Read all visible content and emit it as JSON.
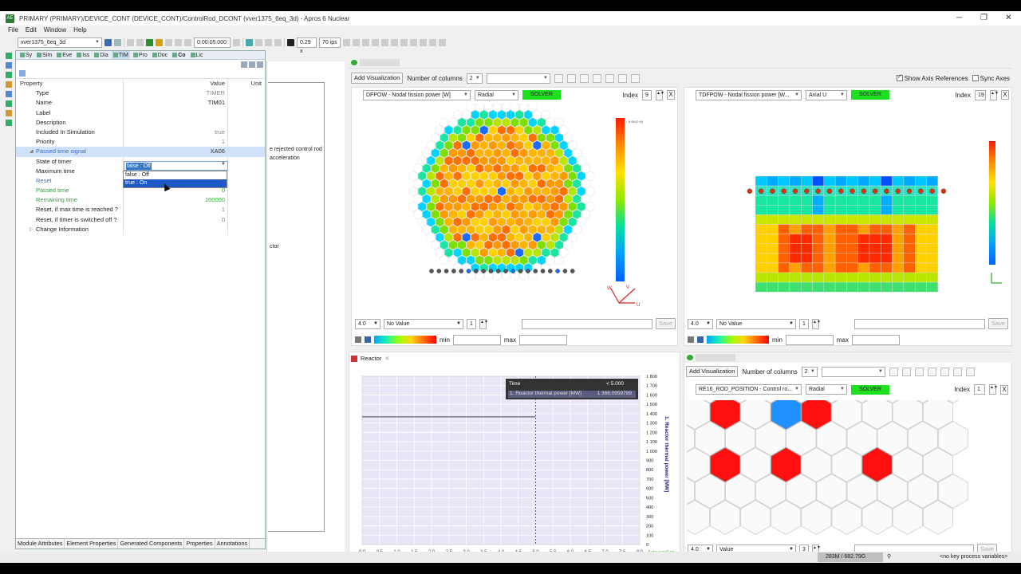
{
  "window": {
    "title": "PRIMARY (PRIMARY)/DEVICE_CONT (DEVICE_CONT)/ControlRod_DCONT (vver1375_6eq_3d) - Apros 6 Nuclear",
    "app_icon": "AE",
    "min": "─",
    "max": "❐",
    "close": "✕"
  },
  "menu": [
    "File",
    "Edit",
    "Window",
    "Help"
  ],
  "toolbar": {
    "model": "vver1375_6eq_3d",
    "time": "0:00:05.000",
    "speed": "0.29 x",
    "ips": "70 ips"
  },
  "left_tabs": [
    "Sy",
    "Sim",
    "Eve",
    "Iss",
    "Dia",
    "TIM",
    "Pro",
    "Doc",
    "Co",
    "Lic"
  ],
  "props": {
    "header": {
      "k": "Property",
      "v": "Value",
      "u": "Unit"
    },
    "rows": [
      {
        "k": "Type",
        "v": "TIMER"
      },
      {
        "k": "Name",
        "v": "TIM01"
      },
      {
        "k": "Label",
        "v": ""
      },
      {
        "k": "Description",
        "v": ""
      },
      {
        "k": "Included In Simulation",
        "v": "true"
      },
      {
        "k": "Priority",
        "v": "1"
      },
      {
        "k": "Passed time signal",
        "v": "XA06"
      },
      {
        "k": "State of timer",
        "v": ""
      },
      {
        "k": "Maximum time",
        "v": ""
      },
      {
        "k": "Reset",
        "v": ""
      },
      {
        "k": "Passed time",
        "v": "0"
      },
      {
        "k": "Remaining time",
        "v": "100000"
      },
      {
        "k": "Reset, if max time is reached ?",
        "v": "1"
      },
      {
        "k": "Reset, if timer is switched off ?",
        "v": "0"
      },
      {
        "k": "Change Information",
        "v": ""
      }
    ],
    "dropdown_value": "false : Off",
    "dropdown_options": [
      "false : Off",
      "true : On"
    ]
  },
  "bottom_tabs": [
    "Module Attributes",
    "Element Properties",
    "Generated Components",
    "Properties",
    "Annotations"
  ],
  "mid_text": [
    "e rejected control rod",
    "acceleration",
    "ctor"
  ],
  "vis_top": {
    "add_button": "Add Visualization",
    "num_cols_label": "Number of columns",
    "num_cols": "2",
    "show_axis_refs": "Show Axis References",
    "sync_axes": "Sync Axes"
  },
  "vis1": {
    "variable": "DFPOW - Nodal fission power [W]",
    "mode": "Radial",
    "solver": "SOLVER",
    "index_label": "Index",
    "index": "9",
    "scale": "4.0",
    "value_mode": "No Value",
    "num": "1",
    "save": "Save",
    "min_label": "min",
    "max_label": "max",
    "cbar_top": "6.6K(E+8)",
    "axis_w": "W",
    "axis_v": "V",
    "axis_u": "U"
  },
  "vis2": {
    "variable": "TDFPOW - Nodal fission power [W...",
    "mode": "Axial U",
    "solver": "SOLVER",
    "index_label": "Index",
    "index": "19",
    "scale": "4.0",
    "value_mode": "No Value",
    "num": "1",
    "save": "Save",
    "min_label": "min",
    "max_label": "max"
  },
  "reactor": {
    "tab": "Reactor",
    "tooltip_time_label": "Time",
    "tooltip_time": "< 5.000",
    "tooltip_series": "1. Reactor thermal power [MW]",
    "tooltip_value": "1 366.0959789",
    "ylabel": "1. Reactor thermal power [MW]",
    "autoscroll": "Auto-scroll on"
  },
  "chart_data": {
    "type": "line",
    "title": "",
    "xlabel": "",
    "ylabel": "1. Reactor thermal power [MW]",
    "x_ticks": [
      "0.0",
      "0.5",
      "1.0",
      "1.5",
      "2.0",
      "2.5",
      "3.0",
      "3.5",
      "4.0",
      "4.5",
      "5.0",
      "5.5",
      "6.0",
      "6.5",
      "7.0",
      "7.5",
      "8.0"
    ],
    "y_ticks": [
      "0",
      "100",
      "200",
      "300",
      "400",
      "500",
      "600",
      "700",
      "800",
      "900",
      "1 000",
      "1 100",
      "1 200",
      "1 300",
      "1 400",
      "1 500",
      "1 600",
      "1 700",
      "1 800"
    ],
    "xlim": [
      0,
      8
    ],
    "ylim": [
      0,
      1800
    ],
    "series": [
      {
        "name": "1. Reactor thermal power [MW]",
        "x": [
          0,
          5.0
        ],
        "y": [
          1366,
          1366
        ]
      }
    ],
    "cursor_x": 5.0,
    "grid": true
  },
  "vis3": {
    "add_button": "Add Visualization",
    "num_cols_label": "Number of columns",
    "num_cols": "2",
    "variable": "RE16_ROD_POSITION - Control ro...",
    "mode": "Radial",
    "solver": "SOLVER",
    "index_label": "Index",
    "index": "1",
    "scale": "4.0",
    "value_mode": "Value",
    "num": "3",
    "save": "Save"
  },
  "status": {
    "memory": "283M / 682.79G",
    "keys": "<no key process variables>"
  },
  "colors": {
    "solver": "#1ee01e",
    "selection": "#cfe2f7",
    "dropdown_hi": "#1e58c7"
  }
}
